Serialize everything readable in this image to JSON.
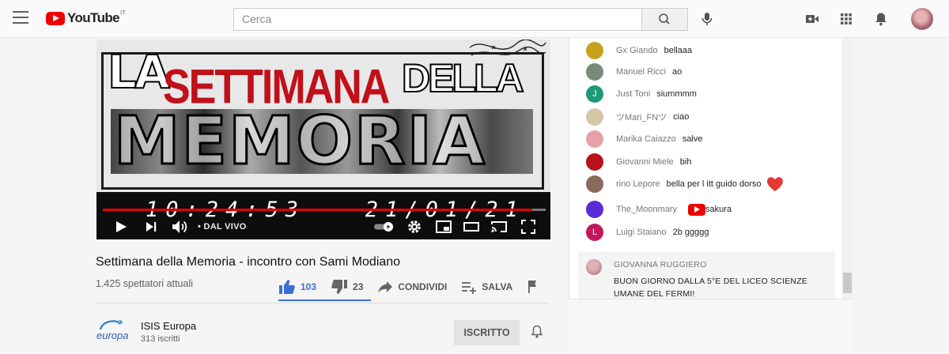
{
  "header": {
    "logo_text": "YouTube",
    "logo_country": "IT",
    "search_placeholder": "Cerca",
    "icons": [
      "menu-icon",
      "search-icon",
      "mic-icon",
      "create-video-icon",
      "apps-icon",
      "notifications-icon"
    ]
  },
  "player": {
    "banner_line1_a": "LA",
    "banner_line1_b": "SETTIMANA",
    "banner_line1_c": "DELLA",
    "banner_line2": "MEMORIA",
    "timestamp": "10:24:53   21/01/21",
    "live_label": "• DAL VIVO",
    "progress_fraction": 0.97,
    "accent_color": "#e60000"
  },
  "video": {
    "title": "Settimana della Memoria - incontro con Sami Modiano",
    "viewers": "1.425 spettatori attuali",
    "likes": "103",
    "dislikes": "23",
    "share_label": "CONDIVIDI",
    "save_label": "SALVA"
  },
  "channel": {
    "logo_text": "europa",
    "name": "ISIS Europa",
    "subscribers": "313 iscritti",
    "subscribe_label": "ISCRITTO"
  },
  "chat": {
    "messages": [
      {
        "author": "Gx Giando",
        "text": "bellaaa",
        "avatar_color": "#c8a020",
        "initial": ""
      },
      {
        "author": "Manuel Ricci",
        "text": "ao",
        "avatar_color": "#7a8a7a",
        "initial": ""
      },
      {
        "author": "Just Toni",
        "text": "siummmm",
        "avatar_color": "#1e9a78",
        "initial": "J"
      },
      {
        "author": "ツMari_FNツ",
        "text": "ciao",
        "avatar_color": "#d6c6a8",
        "initial": ""
      },
      {
        "author": "Marika Caiazzo",
        "text": "salve",
        "avatar_color": "#e8a0a8",
        "initial": ""
      },
      {
        "author": "Giovanni Miele",
        "text": "bih",
        "avatar_color": "#b5121b",
        "initial": ""
      },
      {
        "author": "rino Lepore",
        "text": "bella per l itt guido dorso",
        "avatar_color": "#8a6a5a",
        "initial": ""
      },
      {
        "author": "The_Moonmary",
        "text": "sakura",
        "avatar_color": "#5b2bd6",
        "initial": ""
      },
      {
        "author": "Luigi Staiano",
        "text": "2b ggggg",
        "avatar_color": "#c2185b",
        "initial": "L"
      }
    ],
    "pinned": {
      "author": "GIOVANNA RUGGIERO",
      "text": "BUON GIORNO DALLA 5°E DEL LICEO SCIENZE UMANE DEL FERMI!"
    }
  }
}
